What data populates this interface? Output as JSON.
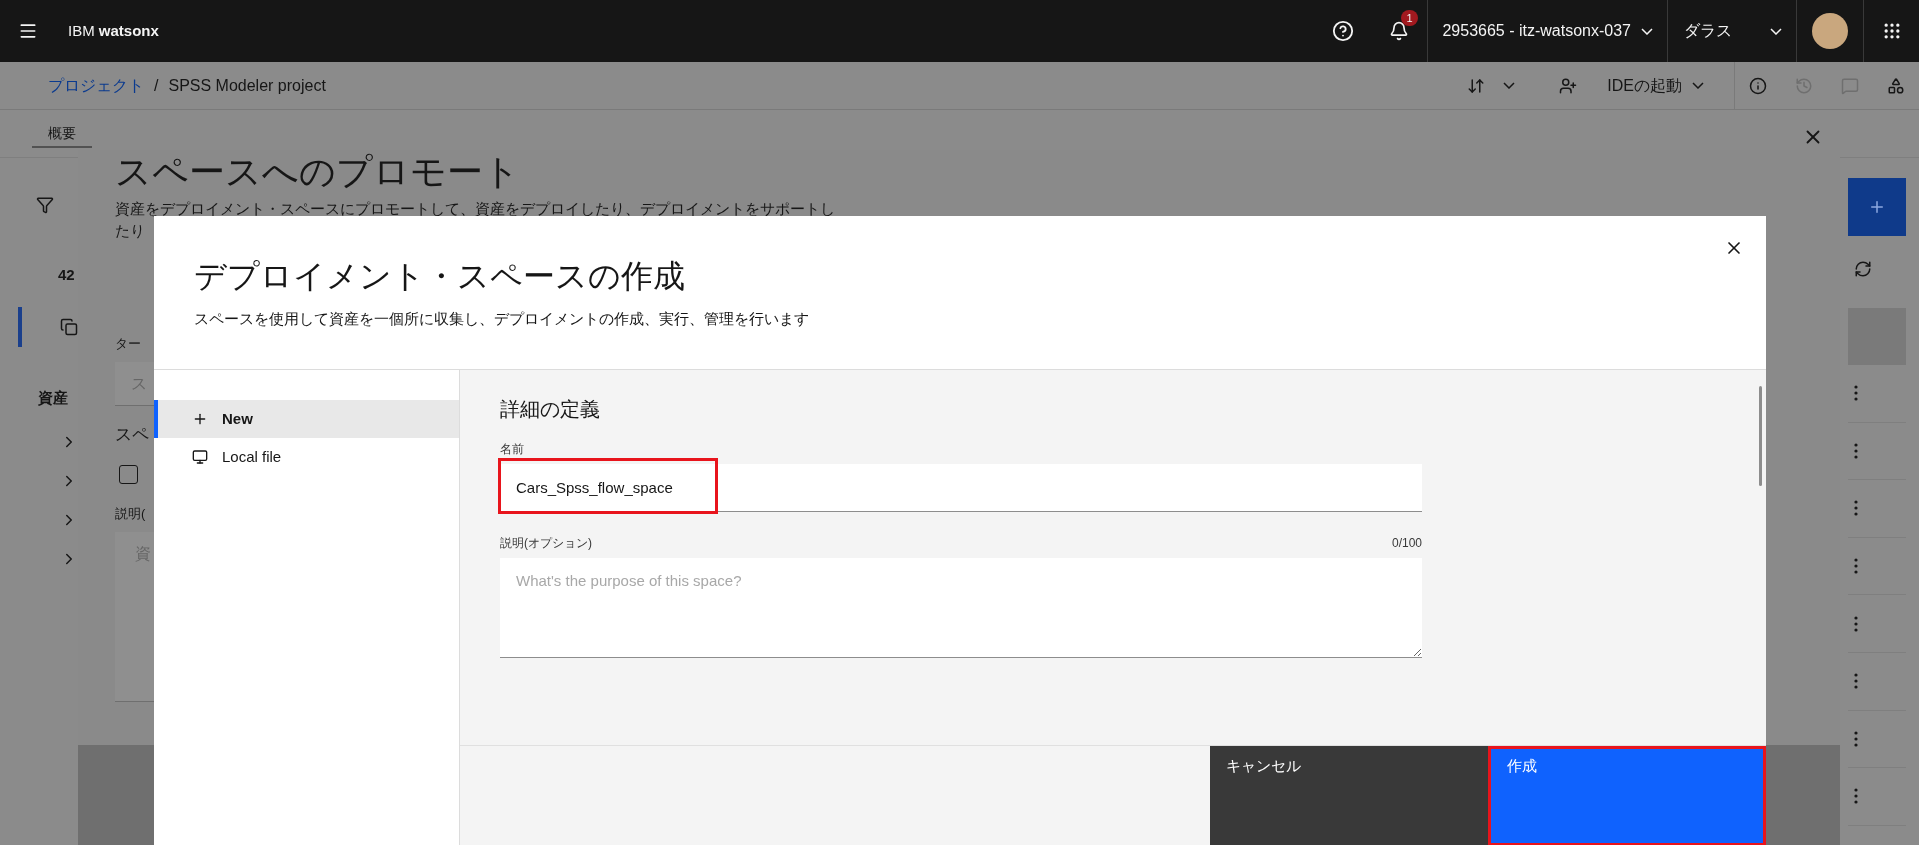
{
  "header": {
    "product": "IBM **watsonx**",
    "notification_count": "1",
    "account": "2953665 - itz-watsonx-037",
    "region": "ダラス"
  },
  "breadcrumb": {
    "parent": "プロジェクト",
    "separator": "/",
    "current": "SPSS Modeler project"
  },
  "toolbar": {
    "ide_button": "IDEの起動"
  },
  "tabs": [
    {
      "label": "概要",
      "selected": true
    }
  ],
  "background": {
    "count": "42",
    "section_label": "資産"
  },
  "promote_panel": {
    "title": "スペースへのプロモート",
    "description": [
      "資産をデプロイメント・スペースにプロモートして、資産をデプロイしたり、デプロイメントをサポートし",
      "たり"
    ],
    "target_label": "ター",
    "target_placeholder": "ス",
    "space_label": "スペ",
    "checkbox_checked": false,
    "description_label": "説明(",
    "description_placeholder": "資"
  },
  "dialog": {
    "title": "デプロイメント・スペースの作成",
    "subtitle": "スペースを使用して資産を一個所に収集し、デプロイメントの作成、実行、管理を行います",
    "sources": [
      {
        "label": "New",
        "kind": "new",
        "selected": true
      },
      {
        "label": "Local file",
        "kind": "file",
        "selected": false
      }
    ],
    "section_title": "詳細の定義",
    "name_label": "名前",
    "name_value": "Cars_Spss_flow_space",
    "name_highlighted": true,
    "description_label": "説明(オプション)",
    "description_counter": "0/100",
    "description_placeholder": "What's the purpose of this space?",
    "buttons": [
      {
        "label": "キャンセル",
        "kind": "secondary",
        "highlighted": false
      },
      {
        "label": "作成",
        "kind": "primary",
        "highlighted": true
      }
    ]
  }
}
